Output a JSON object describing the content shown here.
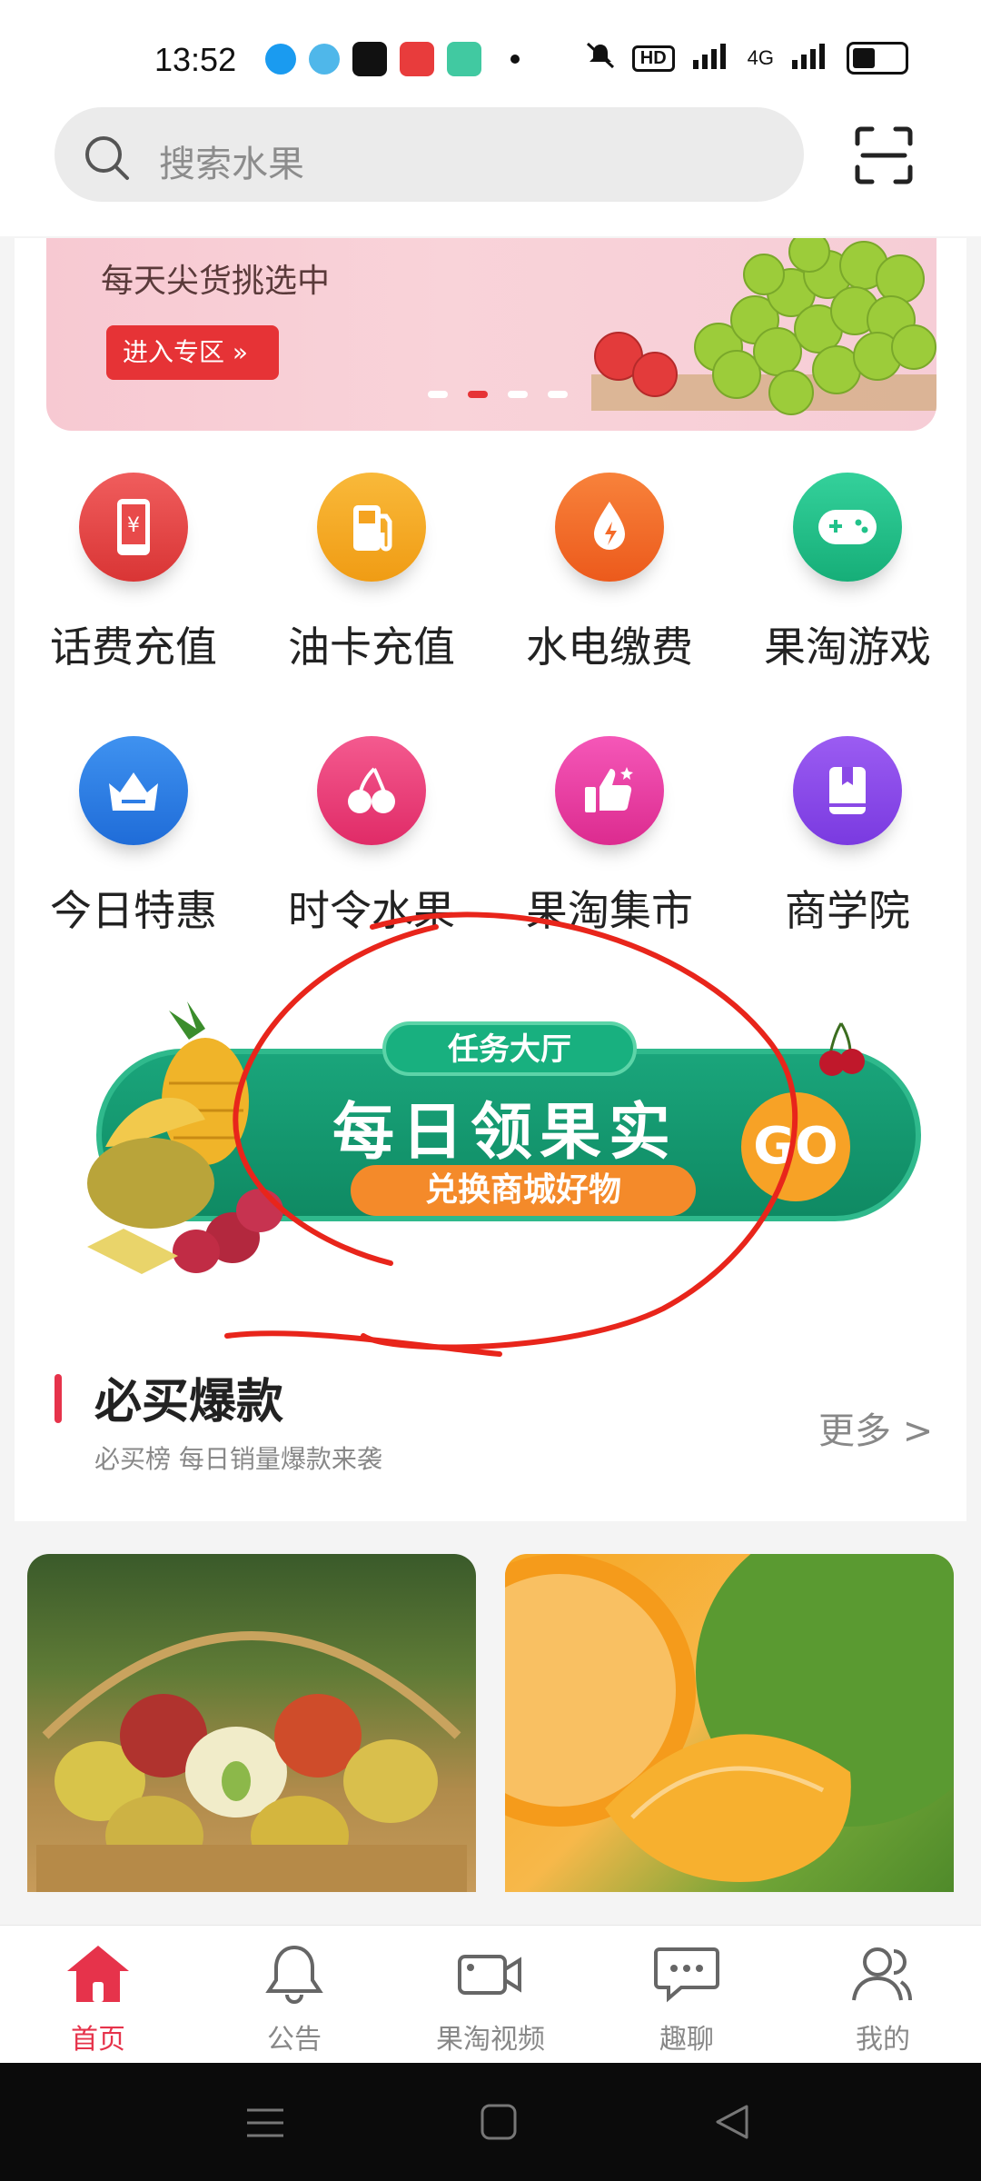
{
  "status_bar": {
    "time": "13:52",
    "network": "4G",
    "hd_label": "HD"
  },
  "search": {
    "placeholder": "搜索水果",
    "icon": "search-icon",
    "scan_icon": "scan-icon"
  },
  "banner": {
    "subtitle": "每天尖货挑选中",
    "button_label": "进入专区 »",
    "active_slide": 2,
    "slide_count": 4
  },
  "grid": [
    {
      "label": "话费充值",
      "icon": "phone-recharge-icon",
      "color": "#e84a4a"
    },
    {
      "label": "油卡充值",
      "icon": "fuel-pump-icon",
      "color": "#f5a320"
    },
    {
      "label": "水电缴费",
      "icon": "water-electric-icon",
      "color": "#f46a28"
    },
    {
      "label": "果淘游戏",
      "icon": "gamepad-icon",
      "color": "#22c28a"
    },
    {
      "label": "今日特惠",
      "icon": "crown-basket-icon",
      "color": "#2e7ee6"
    },
    {
      "label": "时令水果",
      "icon": "cherry-icon",
      "color": "#ee3a78"
    },
    {
      "label": "果淘集市",
      "icon": "thumbs-up-icon",
      "color": "#ea3aa0"
    },
    {
      "label": "商学院",
      "icon": "book-icon",
      "color": "#8a49e6"
    }
  ],
  "promo": {
    "tag": "任务大厅",
    "title": "每日领果实",
    "subtitle": "兑换商城好物",
    "go": "GO"
  },
  "section": {
    "title": "必买爆款",
    "subtitle": "必买榜 每日销量爆款来袭",
    "more": "更多 >"
  },
  "bottom_nav": [
    {
      "label": "首页",
      "icon": "home-icon",
      "active": true
    },
    {
      "label": "公告",
      "icon": "bell-icon",
      "active": false
    },
    {
      "label": "果淘视频",
      "icon": "video-icon",
      "active": false
    },
    {
      "label": "趣聊",
      "icon": "chat-icon",
      "active": false
    },
    {
      "label": "我的",
      "icon": "user-icon",
      "active": false
    }
  ],
  "colors": {
    "accent": "#e6334b",
    "promo_green": "#0f8a63",
    "promo_orange": "#f48a2a"
  }
}
